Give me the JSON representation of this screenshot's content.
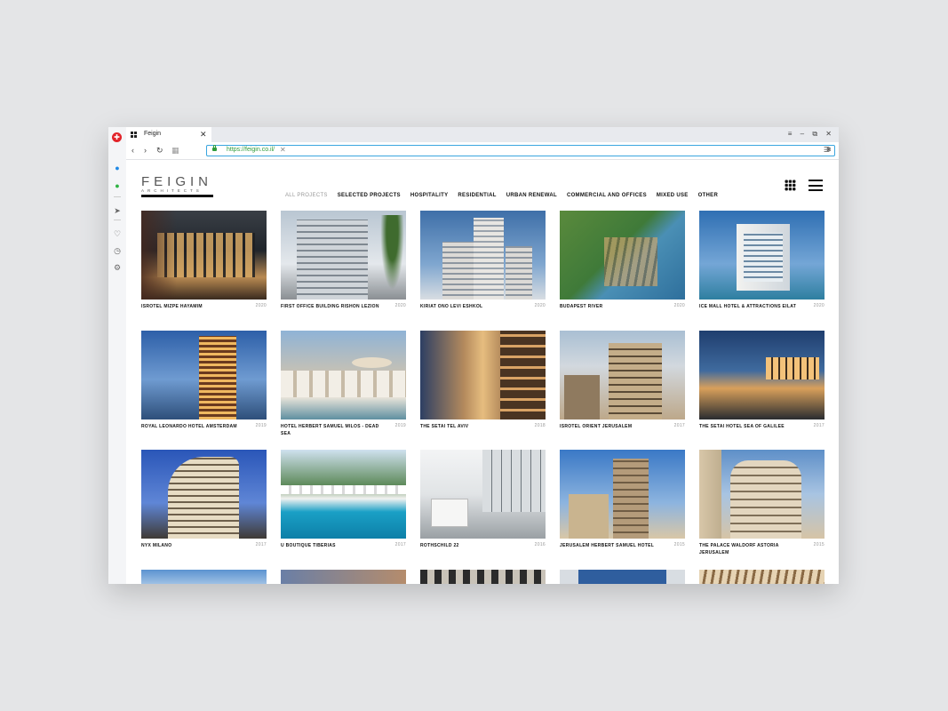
{
  "browser": {
    "tab_title": "Feigin",
    "url": "https://feigin.co.il/",
    "win_min": "–",
    "win_restore": "⧉",
    "win_close": "✕",
    "tab_close": "✕",
    "back": "‹",
    "forward": "›",
    "reload": "↻",
    "clear": "✕"
  },
  "site": {
    "logo_main": "FEIGIN",
    "logo_sub": "ARCHITECTS",
    "nav": [
      {
        "label": "ALL PROJECTS"
      },
      {
        "label": "SELECTED PROJECTS"
      },
      {
        "label": "HOSPITALITY"
      },
      {
        "label": "RESIDENTIAL"
      },
      {
        "label": "URBAN RENEWAL"
      },
      {
        "label": "COMMERCIAL AND OFFICES"
      },
      {
        "label": "MIXED USE"
      },
      {
        "label": "OTHER"
      }
    ],
    "projects": [
      {
        "name": "ISROTEL MIZPE HAYAMIM",
        "year": "2020"
      },
      {
        "name": "FIRST OFFICE BUILDING RISHON LEZION",
        "year": "2020"
      },
      {
        "name": "KIRIAT ONO LEVI ESHKOL",
        "year": "2020"
      },
      {
        "name": "BUDAPEST RIVER",
        "year": "2020"
      },
      {
        "name": "ICE MALL HOTEL & ATTRACTIONS EILAT",
        "year": "2020"
      },
      {
        "name": "ROYAL LEONARDO HOTEL AMSTERDAM",
        "year": "2019"
      },
      {
        "name": "HOTEL HERBERT SAMUEL MILOS - DEAD SEA",
        "year": "2019"
      },
      {
        "name": "THE SETAI TEL AVIV",
        "year": "2018"
      },
      {
        "name": "ISROTEL ORIENT JERUSALEM",
        "year": "2017"
      },
      {
        "name": "THE SETAI HOTEL SEA OF GALILEE",
        "year": "2017"
      },
      {
        "name": "NYX MILANO",
        "year": "2017"
      },
      {
        "name": "U BOUTIQUE TIBERIAS",
        "year": "2017"
      },
      {
        "name": "ROTHSCHILD 22",
        "year": "2016"
      },
      {
        "name": "JERUSALEM HERBERT SAMUEL HOTEL",
        "year": "2015"
      },
      {
        "name": "THE PALACE WALDORF ASTORIA JERUSALEM",
        "year": "2015"
      }
    ]
  }
}
